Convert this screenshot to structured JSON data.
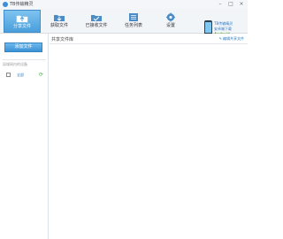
{
  "window": {
    "title": "TB传输精灵",
    "buttons": {
      "minimize": "–",
      "maximize": "□",
      "close": "×"
    }
  },
  "toolbar": {
    "tabs": [
      {
        "label": "分享文件",
        "icon": "share-folder-icon",
        "active": true
      },
      {
        "label": "获取文件",
        "icon": "download-folder-icon",
        "active": false
      },
      {
        "label": "已接收文件",
        "icon": "received-folder-icon",
        "active": false
      },
      {
        "label": "任务列表",
        "icon": "task-list-icon",
        "active": false
      },
      {
        "label": "设置",
        "icon": "gear-icon",
        "active": false
      }
    ]
  },
  "promo": {
    "line1": "TB传输精灵",
    "line2": "安卓端下载",
    "line3": "Android"
  },
  "sidebar": {
    "add_button": "添加文件",
    "section_title": "局域网内的设备",
    "device": {
      "label": "全部",
      "checked": false
    }
  },
  "main": {
    "title": "共享文件库",
    "link": "编辑共享文件"
  },
  "colors": {
    "accent": "#4a9fdc",
    "link": "#2b7bc4",
    "refresh": "#4caf50"
  }
}
